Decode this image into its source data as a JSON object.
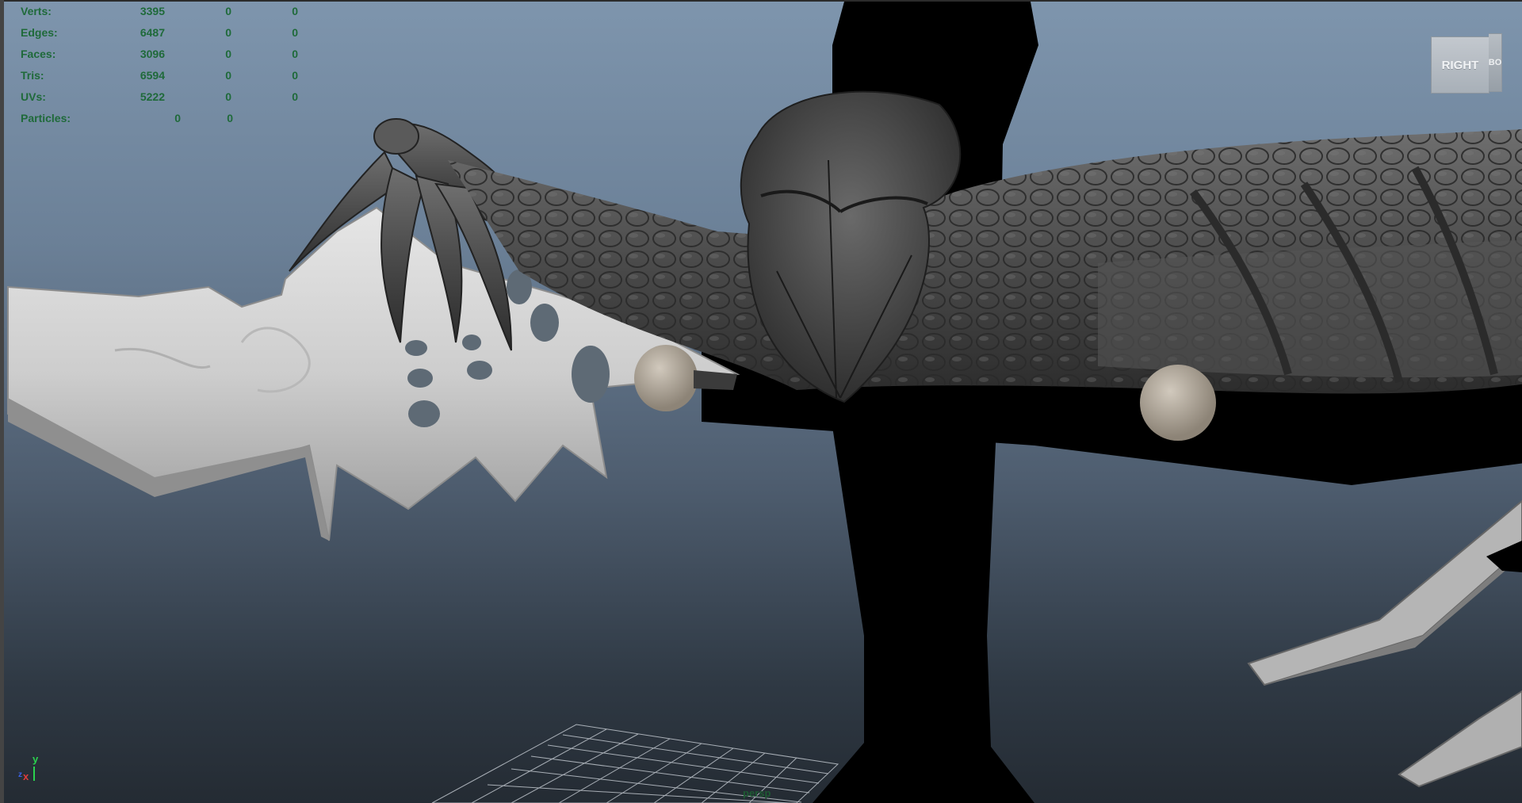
{
  "hud": {
    "rows": [
      {
        "label": "Verts:",
        "v1": "3395",
        "v2": "0",
        "v3": "0"
      },
      {
        "label": "Edges:",
        "v1": "6487",
        "v2": "0",
        "v3": "0"
      },
      {
        "label": "Faces:",
        "v1": "3096",
        "v2": "0",
        "v3": "0"
      },
      {
        "label": "Tris:",
        "v1": "6594",
        "v2": "0",
        "v3": "0"
      },
      {
        "label": "UVs:",
        "v1": "5222",
        "v2": "0",
        "v3": "0"
      }
    ],
    "particles": {
      "label": "Particles:",
      "v1": "0",
      "v2": "0"
    }
  },
  "viewcube": {
    "face_label": "RIGHT",
    "side_label": "BO",
    "icon": "viewcube-icon"
  },
  "axis": {
    "y": "y",
    "x": "x",
    "z": "z",
    "icon": "axis-gizmo-icon"
  },
  "camera": {
    "name": "persp"
  },
  "colors": {
    "hud_text": "#1f6a3a",
    "viewport_top": "#7e95ad",
    "viewport_bottom": "#242b33",
    "axis_y": "#2ad24e",
    "axis_x": "#e03c3c"
  }
}
